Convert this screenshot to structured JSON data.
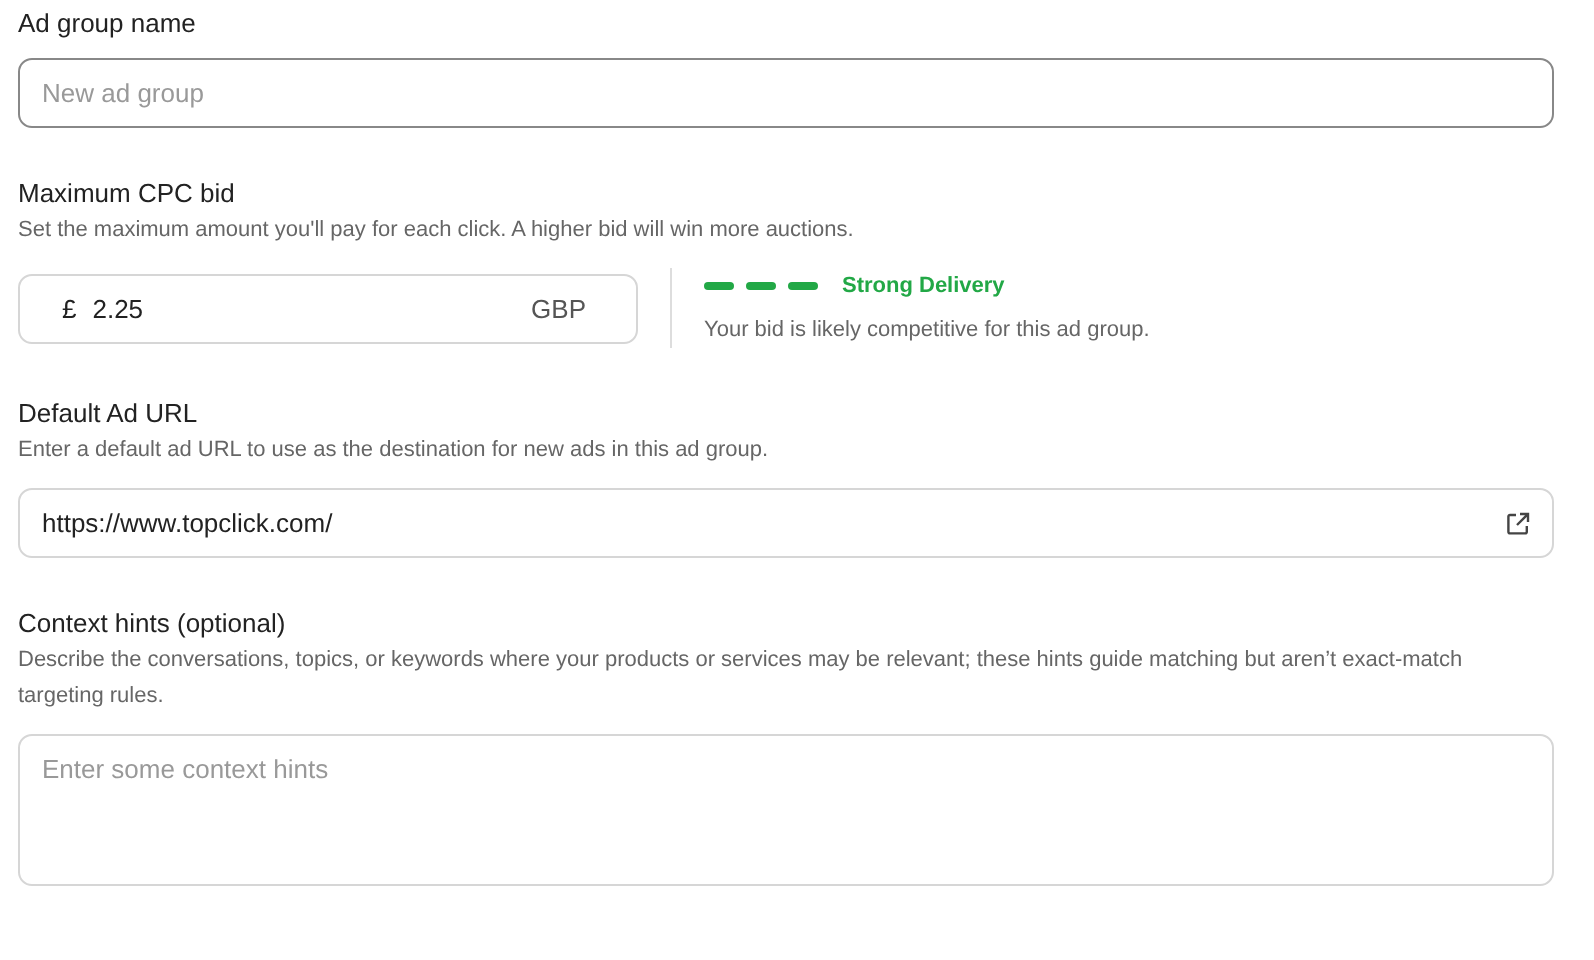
{
  "sections": [
    {
      "kind": "text",
      "label": "Ad group name",
      "field": {
        "placeholder": "New ad group",
        "focused": true
      }
    },
    {
      "kind": "bid",
      "label": "Maximum CPC bid",
      "description": "Set the maximum amount you'll pay for each click. A higher bid will win more auctions.",
      "field": {
        "prefix": "£",
        "value": "2.25",
        "suffix": "GBP",
        "focused": false
      },
      "meter": {
        "segments": [
          {
            "on": true
          },
          {
            "on": true
          },
          {
            "on": true
          }
        ],
        "color": "#22a846",
        "status": "Strong Delivery",
        "note": "Your bid is likely competitive for this ad group."
      }
    },
    {
      "kind": "url",
      "label": "Default Ad URL",
      "description": "Enter a default ad URL to use as the destination for new ads in this ad group.",
      "field": {
        "value": "https://www.topclick.com/",
        "focused": false
      }
    },
    {
      "kind": "textarea",
      "label": "Context hints (optional)",
      "description": "Describe the conversations, topics, or keywords where your products or services may be relevant; these hints guide matching but aren’t exact-match targeting rules.",
      "field": {
        "placeholder": "Enter some context hints",
        "focused": false
      }
    }
  ]
}
